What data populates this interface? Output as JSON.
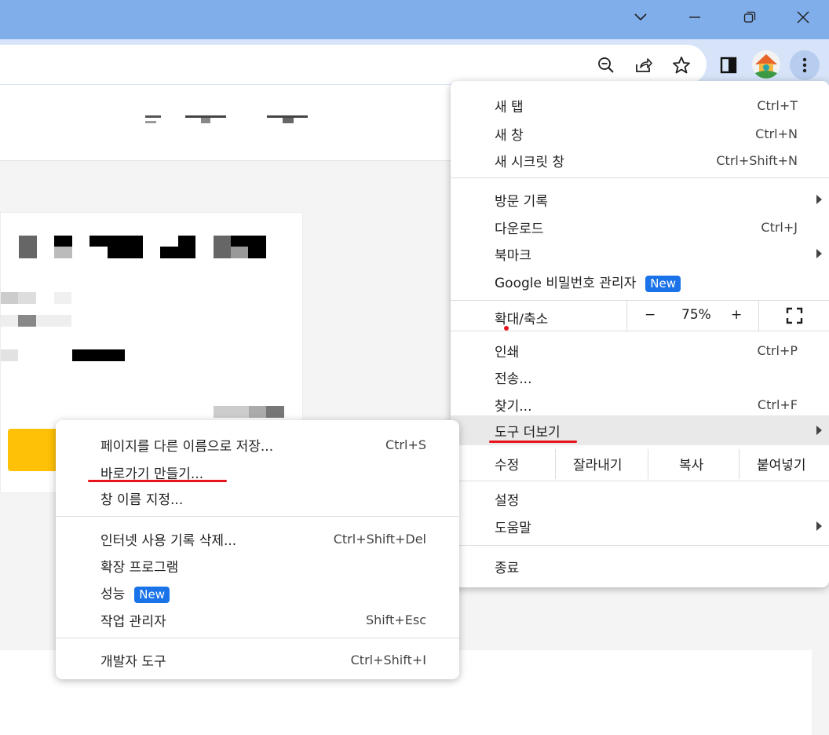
{
  "main_menu": {
    "items": [
      {
        "label": "새 탭",
        "shortcut": "Ctrl+T"
      },
      {
        "label": "새 창",
        "shortcut": "Ctrl+N"
      },
      {
        "label": "새 시크릿 창",
        "shortcut": "Ctrl+Shift+N"
      },
      {
        "label": "방문 기록",
        "shortcut": ""
      },
      {
        "label": "다운로드",
        "shortcut": "Ctrl+J"
      },
      {
        "label": "북마크",
        "shortcut": ""
      },
      {
        "label": "Google 비밀번호 관리자",
        "shortcut": "",
        "badge": "New"
      },
      {
        "label": "인쇄",
        "shortcut": "Ctrl+P"
      },
      {
        "label": "전송...",
        "shortcut": ""
      },
      {
        "label": "찾기...",
        "shortcut": "Ctrl+F"
      },
      {
        "label": "도구 더보기",
        "shortcut": ""
      },
      {
        "label": "설정",
        "shortcut": ""
      },
      {
        "label": "도움말",
        "shortcut": ""
      },
      {
        "label": "종료",
        "shortcut": ""
      }
    ],
    "zoom": {
      "label": "확대/축소",
      "minus": "−",
      "value": "75%",
      "plus": "+"
    },
    "edit": {
      "label": "수정",
      "cut": "잘라내기",
      "copy": "복사",
      "paste": "붙여넣기"
    }
  },
  "sub_menu": {
    "items": [
      {
        "label": "페이지를 다른 이름으로 저장...",
        "shortcut": "Ctrl+S"
      },
      {
        "label": "바로가기 만들기...",
        "shortcut": ""
      },
      {
        "label": "창 이름 지정...",
        "shortcut": ""
      },
      {
        "label": "인터넷 사용 기록 삭제...",
        "shortcut": "Ctrl+Shift+Del"
      },
      {
        "label": "확장 프로그램",
        "shortcut": ""
      },
      {
        "label": "성능",
        "shortcut": "",
        "badge": "New"
      },
      {
        "label": "작업 관리자",
        "shortcut": "Shift+Esc"
      },
      {
        "label": "개발자 도구",
        "shortcut": "Ctrl+Shift+I"
      }
    ]
  },
  "icons": {
    "tab_search": "chevron-down-icon",
    "minimize": "minimize-icon",
    "restore": "restore-icon",
    "close": "close-icon",
    "zoom": "zoom-out-icon",
    "share": "share-icon",
    "bookmark": "star-icon",
    "side_panel": "side-panel-icon",
    "menu": "more-vertical-icon",
    "fullscreen": "fullscreen-icon"
  },
  "colors": {
    "title_bar": "#80aeea",
    "toolbar": "#d6e3f8",
    "badge": "#1a73e8",
    "highlight": "#e9e9e9",
    "annotation": "#e8141c",
    "page_button": "#ffc107"
  }
}
